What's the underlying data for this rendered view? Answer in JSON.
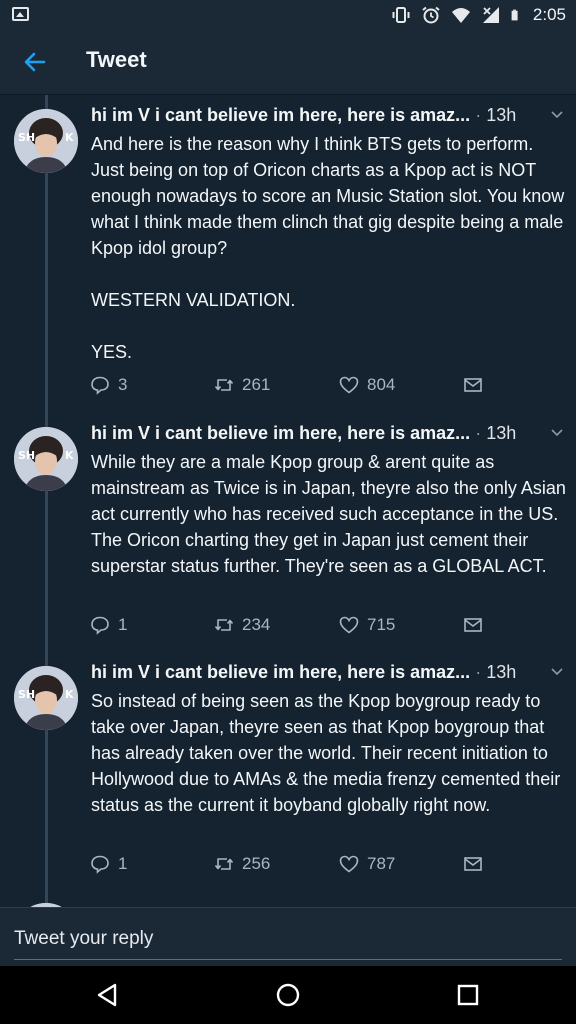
{
  "status_bar": {
    "time": "2:05",
    "icons": [
      "image-icon",
      "vibrate-icon",
      "alarm-icon",
      "wifi-icon",
      "signal-icon",
      "battery-icon"
    ]
  },
  "header": {
    "title": "Tweet",
    "back_icon": "arrow-left-icon"
  },
  "tweets": [
    {
      "name": "hi im V i cant believe im here, here is amaz...",
      "separator": "·",
      "time": "13h",
      "body": "And here is the reason why I think BTS gets to perform. Just being on top of Oricon charts as a Kpop act is NOT enough nowadays to score an Music Station slot. You know what I think made them clinch that gig despite being a male Kpop idol group?\n\nWESTERN VALIDATION.\n\nYES.",
      "replies": "3",
      "retweets": "261",
      "likes": "804"
    },
    {
      "name": "hi im V i cant believe im here, here is amaz...",
      "separator": "·",
      "time": "13h",
      "body": "While they are a male Kpop group & arent quite as mainstream as Twice is in Japan, theyre also the only Asian act currently who has received such acceptance in the US. The Oricon charting they get in Japan just cement their superstar status further. They're seen as a GLOBAL ACT.",
      "replies": "1",
      "retweets": "234",
      "likes": "715"
    },
    {
      "name": "hi im V i cant believe im here, here is amaz...",
      "separator": "·",
      "time": "13h",
      "body": "So instead of being seen as the Kpop boygroup ready to take over Japan, theyre seen as that Kpop boygroup that has already taken over the world. Their recent initiation to Hollywood due to AMAs & the media frenzy cemented their status as the current it boyband globally right now.",
      "replies": "1",
      "retweets": "256",
      "likes": "787"
    }
  ],
  "reply_bar": {
    "placeholder": "Tweet your reply"
  },
  "nav_bar": {
    "icons": [
      "back-triangle-icon",
      "home-circle-icon",
      "recents-square-icon"
    ]
  },
  "colors": {
    "background": "#152331",
    "header": "#1b2836",
    "accent": "#1da1f2",
    "muted": "#8899a6"
  }
}
